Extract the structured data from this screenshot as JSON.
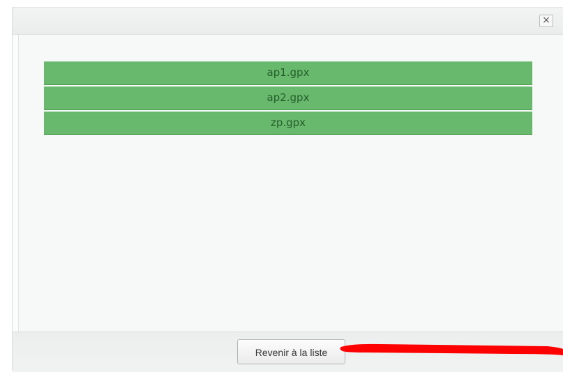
{
  "dialog": {
    "close_glyph": "×"
  },
  "file_list": {
    "items": [
      {
        "label": "ap1.gpx"
      },
      {
        "label": "ap2.gpx"
      },
      {
        "label": "zp.gpx"
      }
    ],
    "item_color": "#68b96d"
  },
  "footer": {
    "back_button_label": "Revenir à la liste"
  },
  "annotation": {
    "color": "#ff0000"
  }
}
